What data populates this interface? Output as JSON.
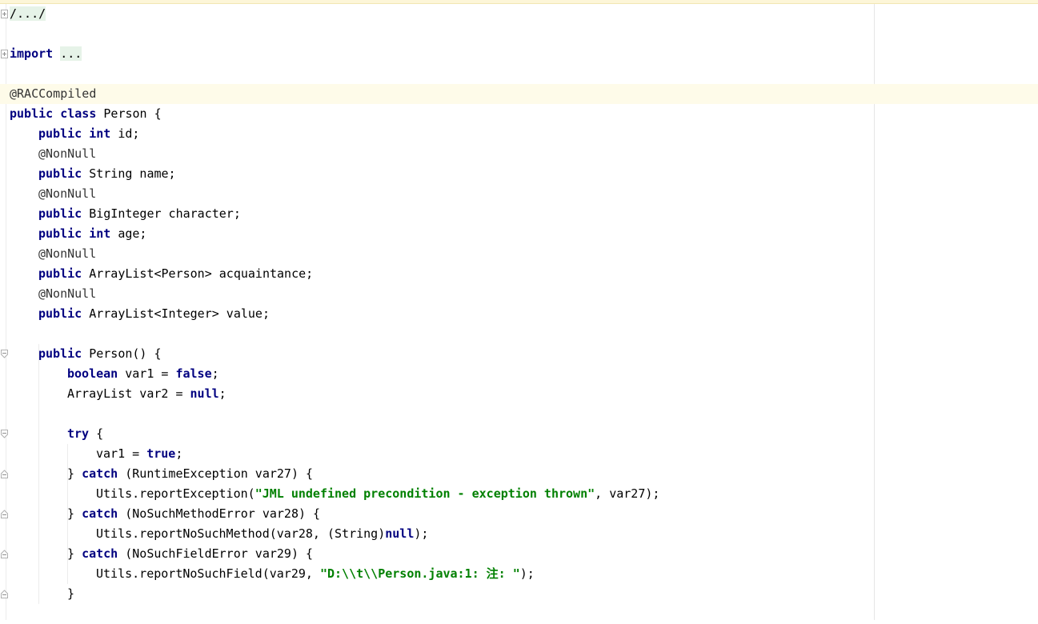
{
  "editor": {
    "lines": [
      {
        "tokens": [
          {
            "t": "/.../",
            "c": "fold-box"
          }
        ],
        "fold": "plus"
      },
      {
        "tokens": []
      },
      {
        "tokens": [
          {
            "t": "import",
            "c": "kw"
          },
          {
            "t": " "
          },
          {
            "t": "...",
            "c": "fold-box"
          }
        ],
        "fold": "plus"
      },
      {
        "tokens": []
      },
      {
        "tokens": [
          {
            "t": "@RACCompiled",
            "c": "ann"
          }
        ],
        "hl": true
      },
      {
        "tokens": [
          {
            "t": "public",
            "c": "kw"
          },
          {
            "t": " "
          },
          {
            "t": "class",
            "c": "kw"
          },
          {
            "t": " Person {"
          }
        ]
      },
      {
        "indent": 4,
        "tokens": [
          {
            "t": "public",
            "c": "kw"
          },
          {
            "t": " "
          },
          {
            "t": "int",
            "c": "kw"
          },
          {
            "t": " id;"
          }
        ]
      },
      {
        "indent": 4,
        "tokens": [
          {
            "t": "@NonNull",
            "c": "ann"
          }
        ]
      },
      {
        "indent": 4,
        "tokens": [
          {
            "t": "public",
            "c": "kw"
          },
          {
            "t": " String name;"
          }
        ]
      },
      {
        "indent": 4,
        "tokens": [
          {
            "t": "@NonNull",
            "c": "ann"
          }
        ]
      },
      {
        "indent": 4,
        "tokens": [
          {
            "t": "public",
            "c": "kw"
          },
          {
            "t": " BigInteger character;"
          }
        ]
      },
      {
        "indent": 4,
        "tokens": [
          {
            "t": "public",
            "c": "kw"
          },
          {
            "t": " "
          },
          {
            "t": "int",
            "c": "kw"
          },
          {
            "t": " age;"
          }
        ]
      },
      {
        "indent": 4,
        "tokens": [
          {
            "t": "@NonNull",
            "c": "ann"
          }
        ]
      },
      {
        "indent": 4,
        "tokens": [
          {
            "t": "public",
            "c": "kw"
          },
          {
            "t": " ArrayList<Person> acquaintance;"
          }
        ]
      },
      {
        "indent": 4,
        "tokens": [
          {
            "t": "@NonNull",
            "c": "ann"
          }
        ]
      },
      {
        "indent": 4,
        "tokens": [
          {
            "t": "public",
            "c": "kw"
          },
          {
            "t": " ArrayList<Integer> value;"
          }
        ]
      },
      {
        "tokens": []
      },
      {
        "indent": 4,
        "tokens": [
          {
            "t": "public",
            "c": "kw"
          },
          {
            "t": " Person() {"
          }
        ],
        "fold": "open"
      },
      {
        "indent": 8,
        "tokens": [
          {
            "t": "boolean",
            "c": "kw"
          },
          {
            "t": " var1 = "
          },
          {
            "t": "false",
            "c": "kw"
          },
          {
            "t": ";"
          }
        ]
      },
      {
        "indent": 8,
        "tokens": [
          {
            "t": "ArrayList var2 = "
          },
          {
            "t": "null",
            "c": "kw"
          },
          {
            "t": ";"
          }
        ]
      },
      {
        "tokens": []
      },
      {
        "indent": 8,
        "tokens": [
          {
            "t": "try",
            "c": "kw"
          },
          {
            "t": " {"
          }
        ],
        "fold": "open"
      },
      {
        "indent": 12,
        "tokens": [
          {
            "t": "var1 = "
          },
          {
            "t": "true",
            "c": "kw"
          },
          {
            "t": ";"
          }
        ]
      },
      {
        "indent": 8,
        "tokens": [
          {
            "t": "} "
          },
          {
            "t": "catch",
            "c": "kw"
          },
          {
            "t": " (RuntimeException var27) {"
          }
        ],
        "fold": "close"
      },
      {
        "indent": 12,
        "tokens": [
          {
            "t": "Utils.reportException("
          },
          {
            "t": "\"JML undefined precondition - exception thrown\"",
            "c": "str"
          },
          {
            "t": ", var27);"
          }
        ]
      },
      {
        "indent": 8,
        "tokens": [
          {
            "t": "} "
          },
          {
            "t": "catch",
            "c": "kw"
          },
          {
            "t": " (NoSuchMethodError var28) {"
          }
        ],
        "fold": "close"
      },
      {
        "indent": 12,
        "tokens": [
          {
            "t": "Utils.reportNoSuchMethod(var28, (String)"
          },
          {
            "t": "null",
            "c": "kw"
          },
          {
            "t": ");"
          }
        ]
      },
      {
        "indent": 8,
        "tokens": [
          {
            "t": "} "
          },
          {
            "t": "catch",
            "c": "kw"
          },
          {
            "t": " (NoSuchFieldError var29) {"
          }
        ],
        "fold": "close"
      },
      {
        "indent": 12,
        "tokens": [
          {
            "t": "Utils.reportNoSuchField(var29, "
          },
          {
            "t": "\"D:\\\\t\\\\Person.java:1: 注: \"",
            "c": "str"
          },
          {
            "t": ");"
          }
        ]
      },
      {
        "indent": 8,
        "tokens": [
          {
            "t": "}"
          }
        ],
        "fold": "close"
      },
      {
        "tokens": []
      }
    ]
  }
}
